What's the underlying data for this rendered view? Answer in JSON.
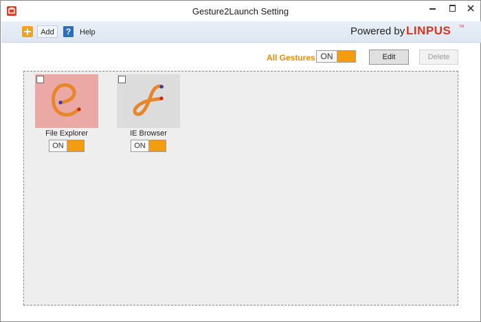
{
  "window": {
    "title": "Gesture2Launch Setting"
  },
  "toolbar": {
    "add_label": "Add",
    "help_label": "Help",
    "help_glyph": "?",
    "powered_text": "Powered by",
    "brand_text": "LINPUS",
    "brand_tm": "TM"
  },
  "controls": {
    "all_gestures_label": "All Gestures",
    "all_gestures_toggle": "ON",
    "edit_label": "Edit",
    "delete_label": "Delete"
  },
  "gestures": [
    {
      "name": "File Explorer",
      "toggle": "ON",
      "icon": "gesture-e-icon",
      "tile_color": "#eba9a6",
      "selected": false
    },
    {
      "name": "IE Browser",
      "toggle": "ON",
      "icon": "gesture-f-icon",
      "tile_color": "#dcdcdc",
      "selected": false
    }
  ],
  "colors": {
    "accent_orange": "#f39c10",
    "label_orange": "#f08a00",
    "brand_red": "#d6341f",
    "help_blue": "#2d6fb7",
    "stroke_orange": "#e8872a"
  }
}
